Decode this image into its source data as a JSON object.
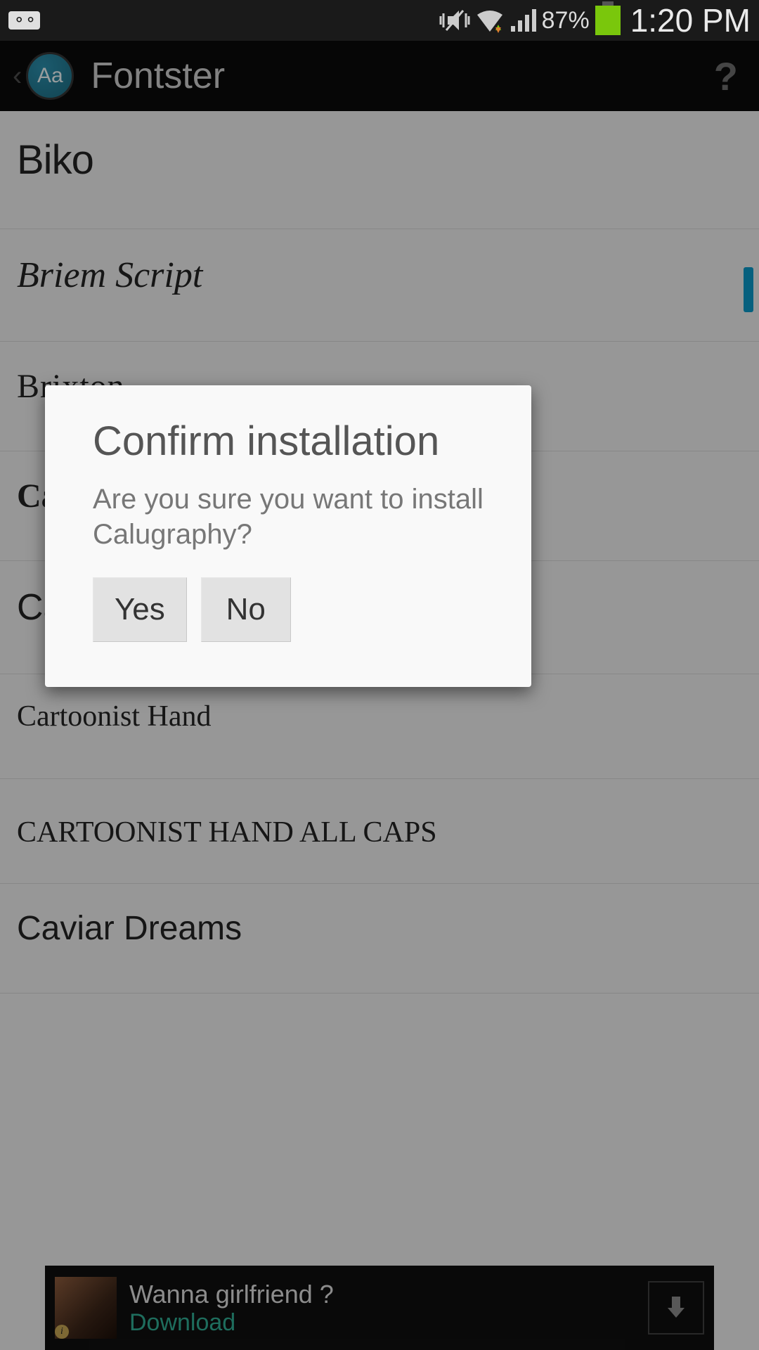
{
  "status": {
    "battery_pct": "87%",
    "clock": "1:20 PM"
  },
  "header": {
    "logo_letters": "Aa",
    "title": "Fontster",
    "help": "?"
  },
  "fonts": [
    {
      "name": "Biko"
    },
    {
      "name": "Briem Script"
    },
    {
      "name": "Brixton"
    },
    {
      "name": "Cal"
    },
    {
      "name": "Ca"
    },
    {
      "name": "Cartoonist Hand"
    },
    {
      "name": "CARTOONIST HAND ALL CAPS"
    },
    {
      "name": "Caviar Dreams"
    }
  ],
  "ad": {
    "title": "Wanna girlfriend ?",
    "cta": "Download",
    "info": "i"
  },
  "dialog": {
    "title": "Confirm installation",
    "message": "Are you sure you want to install Calugraphy?",
    "yes": "Yes",
    "no": "No"
  }
}
